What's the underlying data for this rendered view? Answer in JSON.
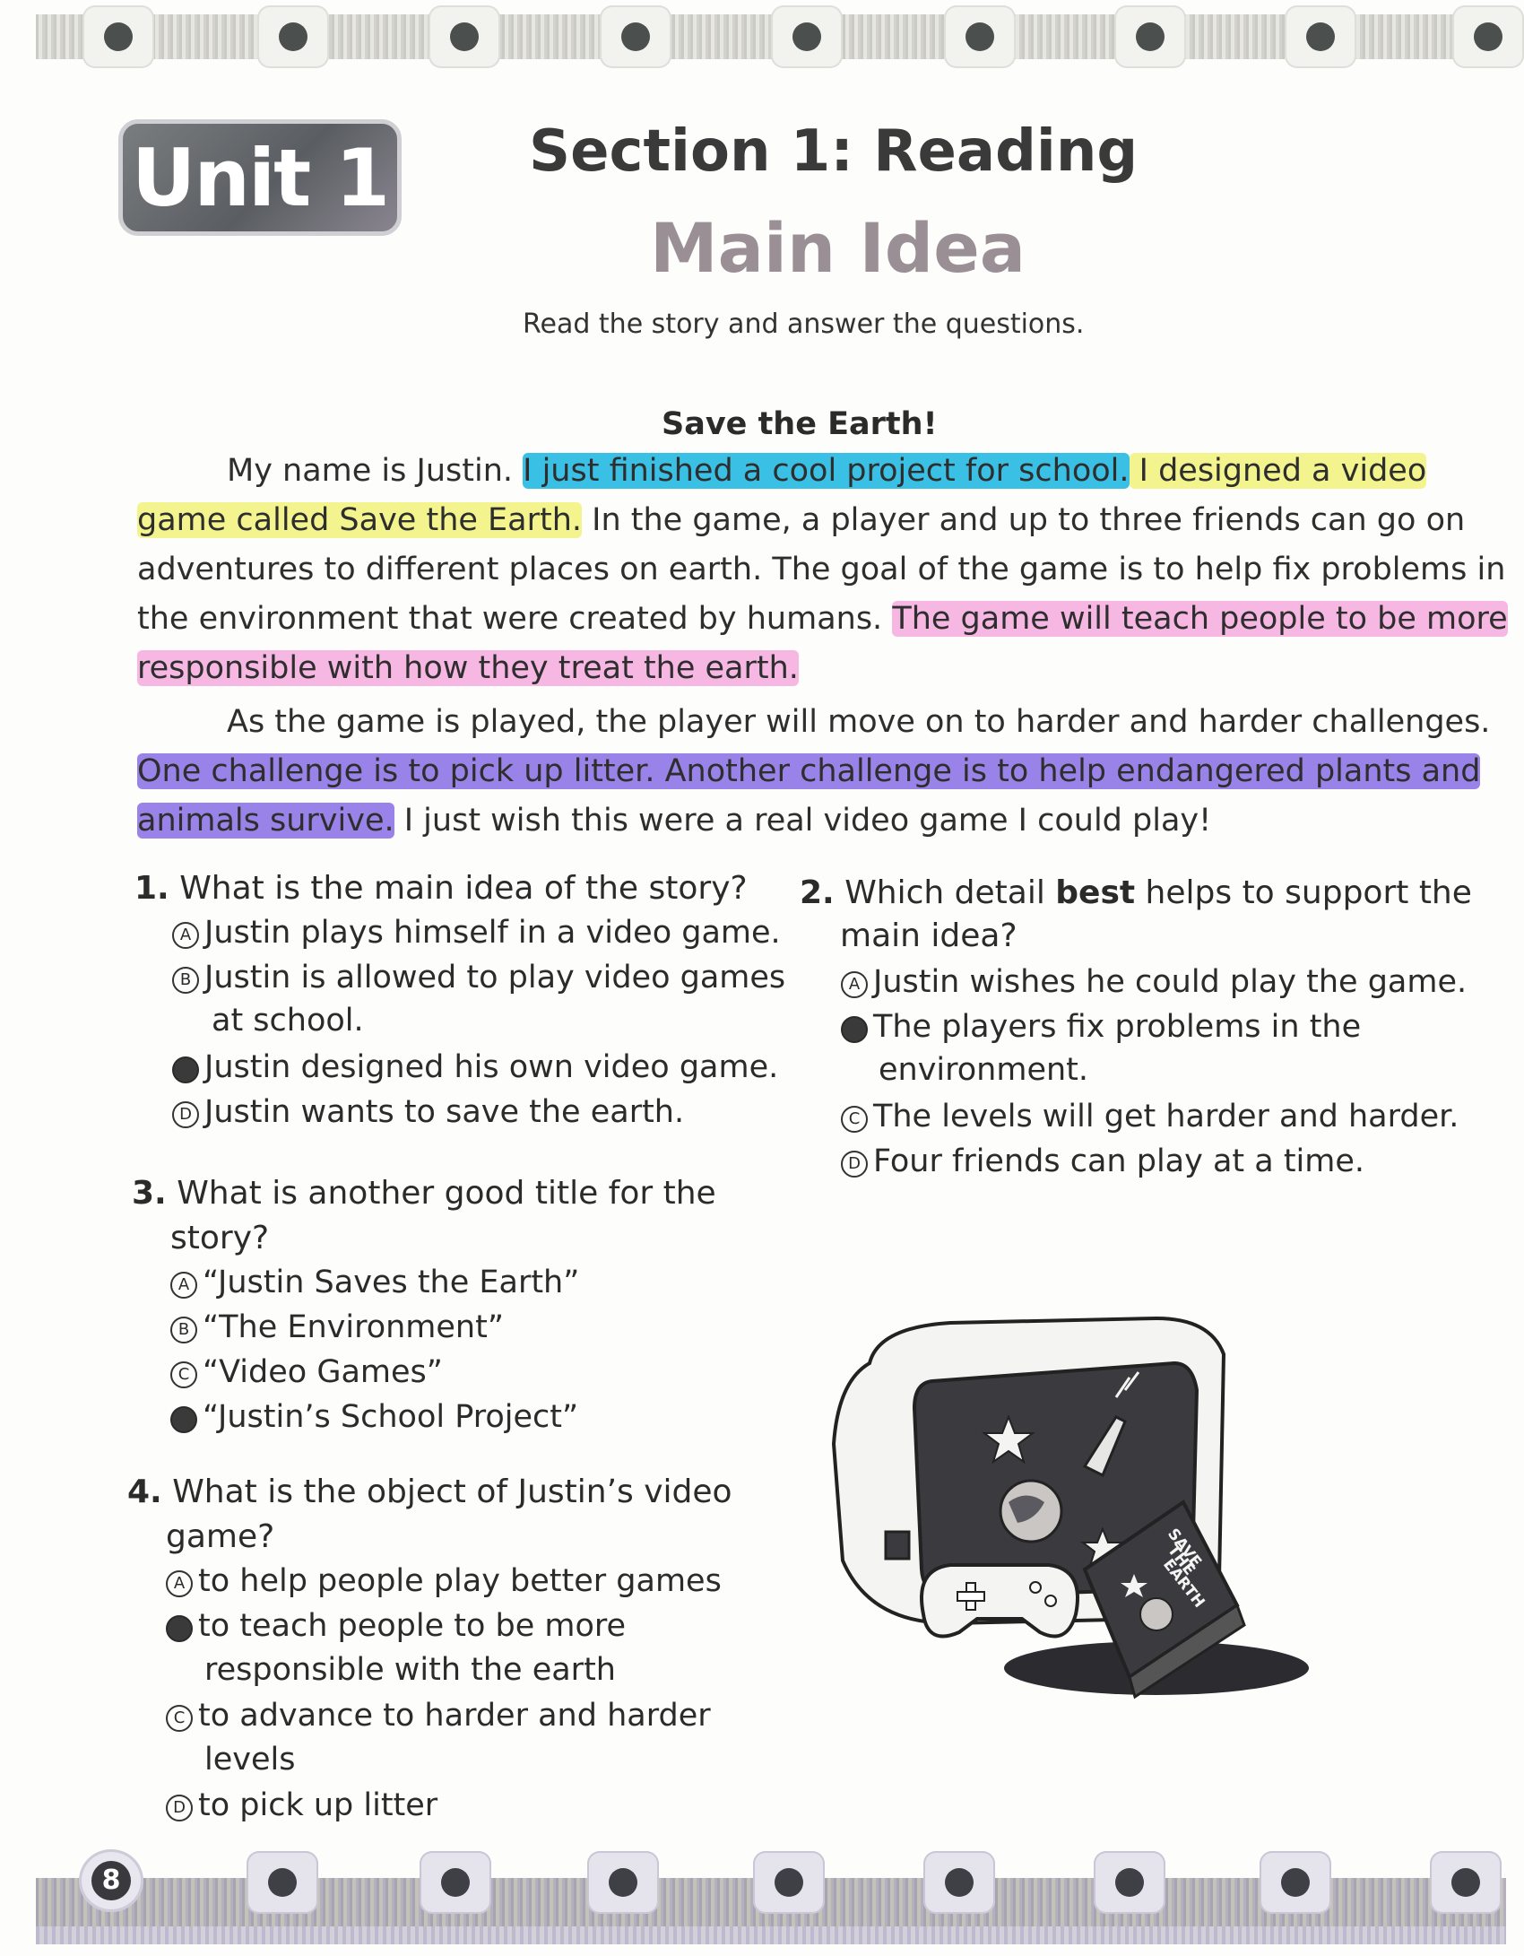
{
  "header": {
    "unit_label": "Unit 1",
    "section_title": "Section 1: Reading",
    "topic": "Main Idea",
    "instructions": "Read the story and answer the questions."
  },
  "story": {
    "title": "Save the Earth!",
    "lines": [
      {
        "plain_before": "My name is Justin. ",
        "hl_blue": "I just finished a cool project for school.",
        "hl_yellow": " I designed a video"
      },
      {
        "hl_yellow": "game called Save the Earth.",
        "plain_after": " In the game, a player and up to three friends can go on"
      },
      {
        "plain": "adventures to different places on earth. The goal of the game is to help fix problems in"
      },
      {
        "plain_before": "the environment that were created by humans. ",
        "hl_pink": "The game will teach people to be more"
      },
      {
        "hl_pink": "responsible with how they treat the earth."
      },
      {
        "plain": "As the game is played, the player will move on to harder and harder challenges."
      },
      {
        "hl_purple": "One challenge is to pick up litter. Another challenge is to help endangered plants and"
      },
      {
        "hl_purple": "animals survive.",
        "plain_after": " I just wish this were a real video game I could play!"
      }
    ]
  },
  "questions": [
    {
      "number": "1.",
      "text_lines": [
        "What is the main idea of the story?"
      ],
      "options": [
        {
          "letter": "A",
          "lines": [
            "Justin plays himself in a video game."
          ],
          "filled": false
        },
        {
          "letter": "B",
          "lines": [
            "Justin is allowed to play video games",
            "at school."
          ],
          "filled": false
        },
        {
          "letter": "C",
          "lines": [
            "Justin designed his own video game."
          ],
          "filled": true
        },
        {
          "letter": "D",
          "lines": [
            "Justin wants to save the earth."
          ],
          "filled": false
        }
      ]
    },
    {
      "number": "2.",
      "text_before_bold": "Which detail ",
      "text_bold": "best",
      "text_after_bold": " helps to support the",
      "text_line2": "main idea?",
      "options": [
        {
          "letter": "A",
          "lines": [
            "Justin wishes he could play the game."
          ],
          "filled": false
        },
        {
          "letter": "B",
          "lines": [
            "The players fix problems in the",
            "environment."
          ],
          "filled": true
        },
        {
          "letter": "C",
          "lines": [
            "The levels will get harder and harder."
          ],
          "filled": false
        },
        {
          "letter": "D",
          "lines": [
            "Four friends can play at a time."
          ],
          "filled": false
        }
      ]
    },
    {
      "number": "3.",
      "text_lines": [
        "What is another good title for the",
        "story?"
      ],
      "options": [
        {
          "letter": "A",
          "lines": [
            "“Justin Saves the Earth”"
          ],
          "filled": false
        },
        {
          "letter": "B",
          "lines": [
            "“The Environment”"
          ],
          "filled": false
        },
        {
          "letter": "C",
          "lines": [
            "“Video Games”"
          ],
          "filled": false
        },
        {
          "letter": "D",
          "lines": [
            "“Justin’s School Project”"
          ],
          "filled": true
        }
      ]
    },
    {
      "number": "4.",
      "text_lines": [
        "What is the object of Justin’s video",
        "game?"
      ],
      "options": [
        {
          "letter": "A",
          "lines": [
            "to help people play better games"
          ],
          "filled": false
        },
        {
          "letter": "B",
          "lines": [
            "to teach people to be more",
            "responsible with the earth"
          ],
          "filled": true
        },
        {
          "letter": "C",
          "lines": [
            "to advance to harder and harder",
            "levels"
          ],
          "filled": false
        },
        {
          "letter": "D",
          "lines": [
            "to pick up litter"
          ],
          "filled": false
        }
      ]
    }
  ],
  "illustration": {
    "box_text_lines": [
      "SAVE",
      "THE",
      "EARTH"
    ],
    "icons": [
      "monitor-icon",
      "game-controller-icon",
      "game-box-icon",
      "star-icon",
      "planet-icon",
      "rocket-icon"
    ]
  },
  "footer": {
    "page_number": "8"
  },
  "colors": {
    "highlight_blue": "#39c0e4",
    "highlight_yellow": "#f3f48e",
    "highlight_pink": "#f6b7e3",
    "highlight_purple": "#9a83e8"
  }
}
